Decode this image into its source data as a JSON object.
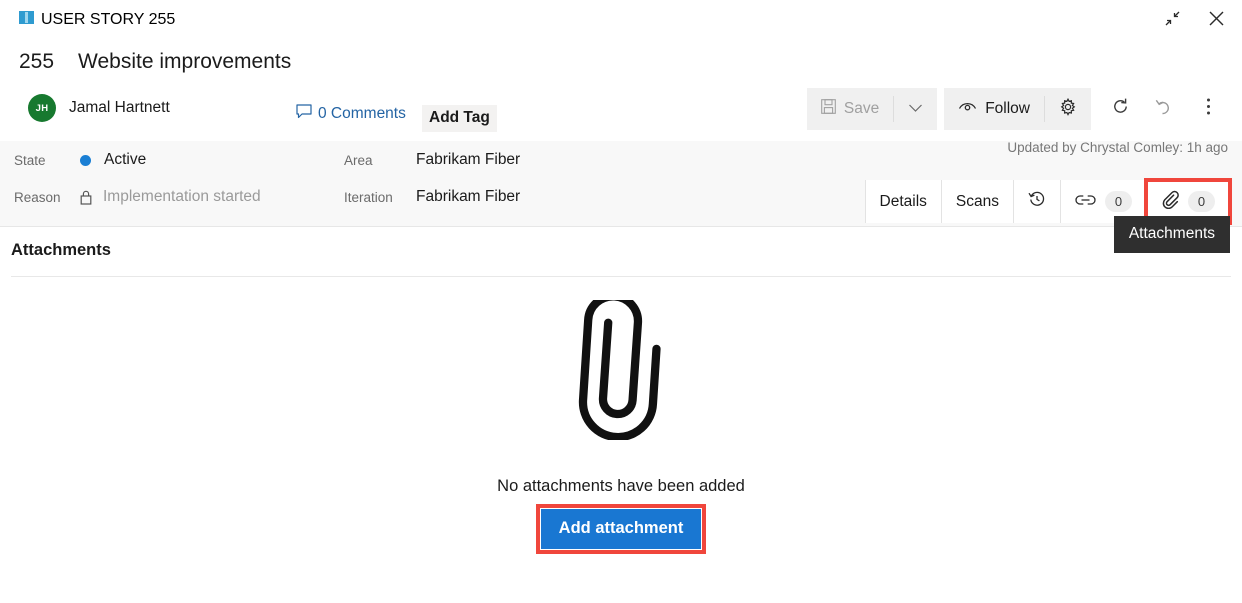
{
  "window": {
    "work_item_type": "USER STORY 255",
    "work_item_type_icon": "user-story-book-icon",
    "minimize_icon": "restore-down-icon",
    "close_icon": "close-icon"
  },
  "header": {
    "id": "255",
    "title": "Website improvements",
    "assignee": {
      "initials": "JH",
      "name": "Jamal Hartnett",
      "avatar_color": "#17792f"
    },
    "comments_label": "0 Comments",
    "comments_icon": "comment-bubble-icon",
    "add_tag_label": "Add Tag"
  },
  "toolbar": {
    "save_label": "Save",
    "save_icon": "save-disk-icon",
    "save_enabled": false,
    "save_dropdown_icon": "chevron-down-icon",
    "follow_label": "Follow",
    "follow_icon": "eye-icon",
    "settings_icon": "gear-icon",
    "refresh_icon": "refresh-icon",
    "revert_icon": "undo-icon",
    "more_icon": "more-vertical-icon"
  },
  "info": {
    "fields": [
      {
        "label": "State",
        "value": "Active",
        "marker": "state-dot",
        "muted": false
      },
      {
        "label": "Reason",
        "value": "Implementation started",
        "marker": "lock-icon",
        "muted": true
      },
      {
        "label": "Area",
        "value": "Fabrikam Fiber",
        "marker": "",
        "muted": false
      },
      {
        "label": "Iteration",
        "value": "Fabrikam Fiber",
        "marker": "",
        "muted": false
      }
    ],
    "updated_by": "Updated by Chrystal Comley: 1h ago",
    "state_dot_color": "#1a7fd4"
  },
  "tabs": [
    {
      "label": "Details",
      "icon": "",
      "count": "",
      "active": false,
      "highlighted": false
    },
    {
      "label": "Scans",
      "icon": "",
      "count": "",
      "active": false,
      "highlighted": false
    },
    {
      "label": "",
      "icon": "history-clock-icon",
      "count": "",
      "active": false,
      "highlighted": false
    },
    {
      "label": "",
      "icon": "link-chain-icon",
      "count": "0",
      "active": false,
      "highlighted": false
    },
    {
      "label": "",
      "icon": "paperclip-icon",
      "count": "0",
      "active": true,
      "highlighted": true
    }
  ],
  "tooltip": {
    "text": "Attachments"
  },
  "main": {
    "section_title": "Attachments",
    "empty_icon": "large-paperclip-icon",
    "empty_text": "No attachments have been added",
    "add_attachment_label": "Add attachment"
  },
  "colors": {
    "accent_bar": "#2b9cc9",
    "primary_button": "#1977d2",
    "highlight_box": "#f0463c",
    "link": "#2464a4",
    "tab_underline": "#0f6cbd",
    "tooltip_bg": "#2f2f2f"
  }
}
